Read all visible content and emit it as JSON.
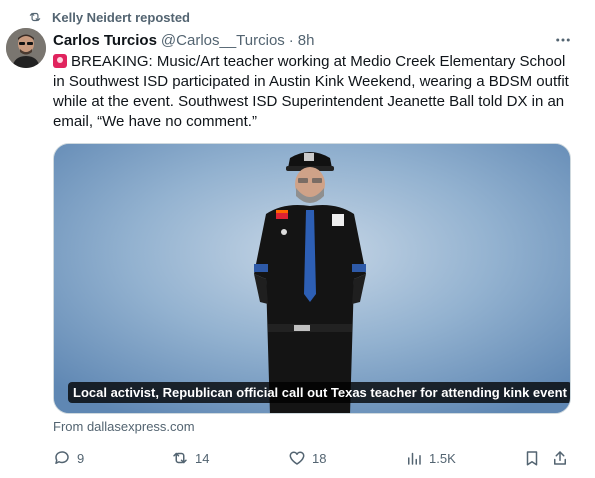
{
  "repost": {
    "icon": "repost-icon",
    "label": "Kelly Neidert reposted"
  },
  "tweet": {
    "author": {
      "display_name": "Carlos Turcios",
      "handle": "@Carlos__Turcios",
      "separator": "·",
      "time": "8h",
      "avatar": "avatar"
    },
    "more_icon": "more-icon",
    "text": "BREAKING: Music/Art teacher working at Medio Creek Elementary School in Southwest ISD participated in Austin Kink Weekend, wearing a BDSM outfit while at the event. Southwest ISD Superintendent Jeanette Ball told DX in an email, “We have no comment.”",
    "media": {
      "caption": "Local activist, Republican official call out Texas teacher for attending kink event"
    },
    "source": "From dallasexpress.com",
    "actions": {
      "replies": "9",
      "reposts": "14",
      "likes": "18",
      "views": "1.5K"
    }
  },
  "colors": {
    "text_primary": "#0f1419",
    "text_secondary": "#536471",
    "siren": "#e0245e",
    "border": "#cfd9de"
  }
}
